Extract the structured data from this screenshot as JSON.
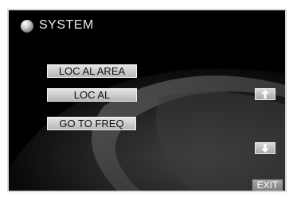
{
  "header": {
    "title": "SYSTEM",
    "icon": "disc-icon"
  },
  "menu": {
    "items": [
      {
        "label": "LOC AL AREA"
      },
      {
        "label": "LOC AL"
      },
      {
        "label": "GO TO FREQ"
      }
    ]
  },
  "scroll": {
    "up_icon": "arrow-up-icon",
    "down_icon": "arrow-down-icon"
  },
  "footer": {
    "exit_label": "EXIT"
  }
}
